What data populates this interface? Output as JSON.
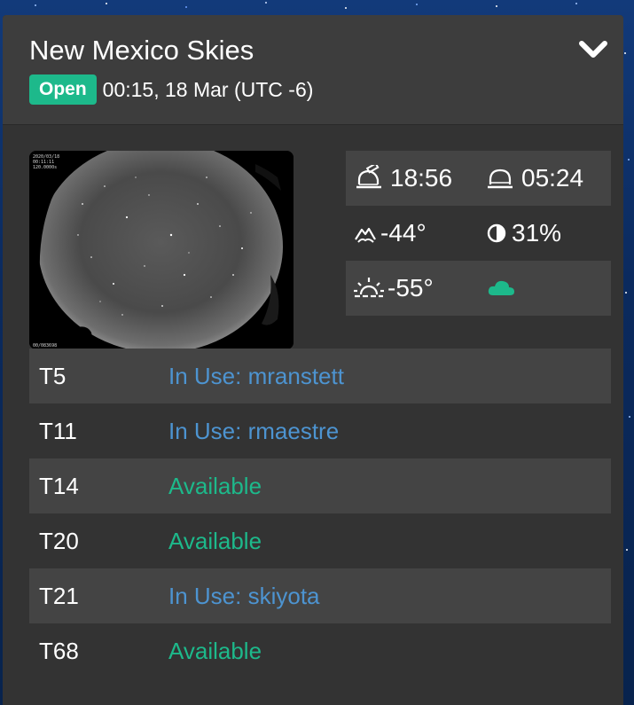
{
  "site": {
    "title": "New Mexico Skies",
    "status_badge": "Open",
    "datetime": "00:15, 18 Mar (UTC -6)"
  },
  "allsky_overlay": {
    "line1": "2020/03/18",
    "line2": "00:11:11",
    "line3": "120.0000s",
    "corner": "00/083698"
  },
  "weather": {
    "sunset_time": "18:56",
    "sunrise_time": "05:24",
    "dewpoint": "-44°",
    "moon_illumination": "31%",
    "sun_altitude": "-55°",
    "cloud_color": "#1db98b"
  },
  "icons": {
    "header_toggle": "chevron-down-icon",
    "sunset": "observatory-open-icon",
    "sunrise": "observatory-closed-icon",
    "dewpoint": "mountain-cloud-icon",
    "moon": "half-moon-icon",
    "sun": "sun-horizon-icon",
    "clouds": "cloud-icon"
  },
  "colors": {
    "open_badge": "#1db98b",
    "in_use": "#4d94d1",
    "available": "#1db98b"
  },
  "telescopes": [
    {
      "name": "T5",
      "status": "In Use: mranstett",
      "state": "in_use"
    },
    {
      "name": "T11",
      "status": "In Use: rmaestre",
      "state": "in_use"
    },
    {
      "name": "T14",
      "status": "Available",
      "state": "available"
    },
    {
      "name": "T20",
      "status": "Available",
      "state": "available"
    },
    {
      "name": "T21",
      "status": "In Use: skiyota",
      "state": "in_use"
    },
    {
      "name": "T68",
      "status": "Available",
      "state": "available"
    }
  ]
}
